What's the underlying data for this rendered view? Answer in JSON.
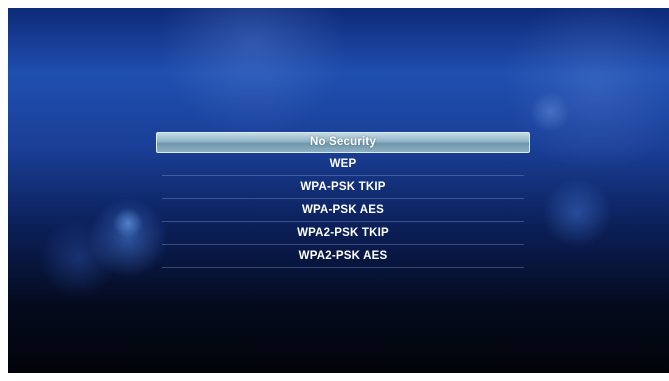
{
  "security_menu": {
    "items": [
      {
        "label": "No Security",
        "selected": true
      },
      {
        "label": "WEP",
        "selected": false
      },
      {
        "label": "WPA-PSK TKIP",
        "selected": false
      },
      {
        "label": "WPA-PSK AES",
        "selected": false
      },
      {
        "label": "WPA2-PSK TKIP",
        "selected": false
      },
      {
        "label": "WPA2-PSK AES",
        "selected": false
      }
    ]
  },
  "colors": {
    "background_top": "#1f4fb0",
    "background_bottom": "#020409",
    "highlight": "#8fb3c6",
    "text": "#ffffff"
  }
}
